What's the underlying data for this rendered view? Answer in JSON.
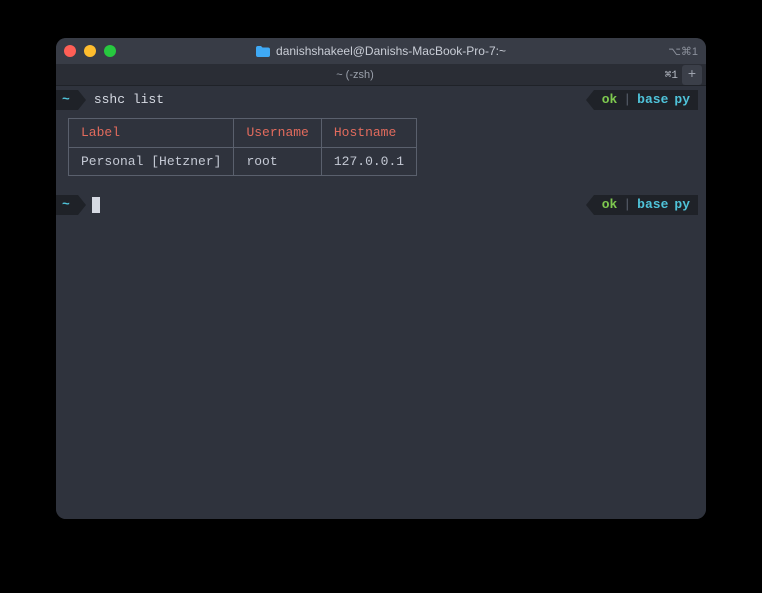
{
  "window": {
    "title": "danishshakeel@Danishs-MacBook-Pro-7:~",
    "titlebar_shortcut": "⌥⌘1"
  },
  "tabs": {
    "active_label": "~ (-zsh)",
    "shortcut": "⌘1",
    "new_tab_label": "+"
  },
  "prompt1": {
    "dir": "~",
    "command": "sshc list",
    "status_ok": "ok",
    "status_sep": "|",
    "status_env": "base",
    "status_lang": "py"
  },
  "table": {
    "headers": [
      "Label",
      "Username",
      "Hostname"
    ],
    "rows": [
      [
        "Personal [Hetzner]",
        "root",
        "127.0.0.1"
      ]
    ]
  },
  "prompt2": {
    "dir": "~",
    "status_ok": "ok",
    "status_sep": "|",
    "status_env": "base",
    "status_lang": "py"
  }
}
